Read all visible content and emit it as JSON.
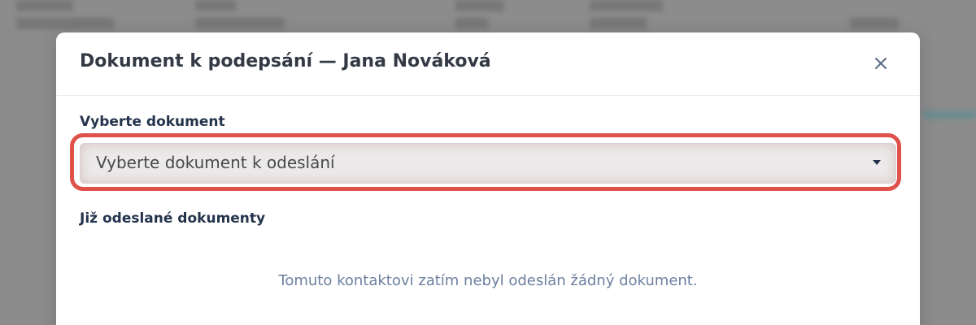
{
  "modal": {
    "title": "Dokument k podepsání — Jana Nováková",
    "close_icon": "close-icon",
    "document_select": {
      "label": "Vyberte dokument",
      "selected_value": "Vyberte dokument k odeslání",
      "highlight_color": "#e0514c"
    },
    "sent_documents": {
      "heading": "Již odeslané dokumenty",
      "empty_message": "Tomuto kontaktovi zatím nebyl odeslán žádný dokument."
    }
  }
}
